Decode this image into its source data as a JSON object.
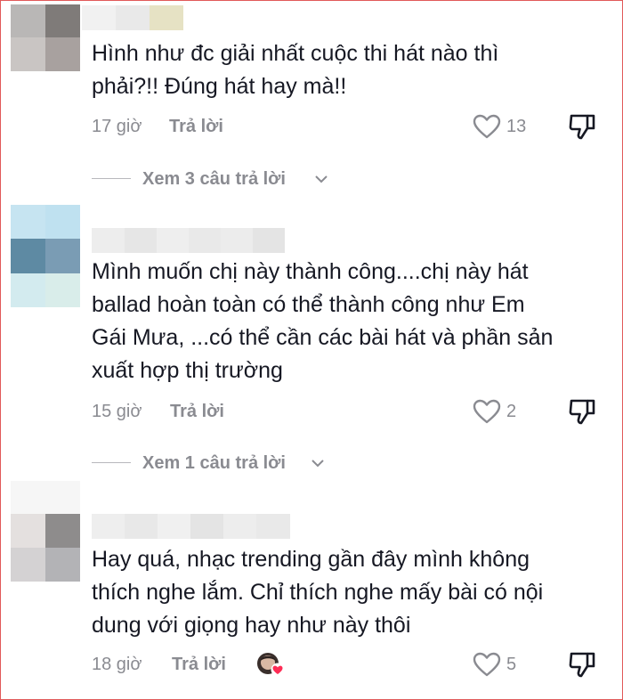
{
  "comments": [
    {
      "text_lines": [
        "Hình như đc giải nhất cuộc thi hát nào thì",
        "phải?!! Đúng hát hay mà!!"
      ],
      "time": "17 giờ",
      "reply_label": "Trả lời",
      "likes": "13",
      "view_replies": "Xem 3 câu trả lời",
      "avatar_colors": [
        "#b9b7b6",
        "#7f7b79",
        "#c9c5c3",
        "#a8a19f"
      ],
      "name_colors": [
        "#f1f1f1",
        "#e9e9e9",
        "#ecebe2",
        "#e6e2c4"
      ]
    },
    {
      "text_lines": [
        "Mình muốn chị này thành công....chị này hát",
        "ballad hoàn toàn có thể thành công như Em",
        "Gái Mưa, ...có thể cần các bài hát và phần sản",
        "xuất hợp thị trường"
      ],
      "time": "15 giờ",
      "reply_label": "Trả lời",
      "likes": "2",
      "view_replies": "Xem 1 câu trả lời",
      "avatar_colors": [
        "#c6e4f1",
        "#bfe1f0",
        "#5e8aa3",
        "#7a9cb4",
        "#d3ebef",
        "#d9edea"
      ],
      "name_colors": [
        "#ededed",
        "#e6e6e6",
        "#eeeeee",
        "#e9e9e9",
        "#ececec",
        "#e4e4e4"
      ]
    },
    {
      "text_lines": [
        "Hay quá, nhạc trending gần đây mình không",
        "thích nghe lắm. Chỉ thích nghe mấy bài có nội",
        "dung với giọng hay như này thôi"
      ],
      "time": "18 giờ",
      "reply_label": "Trả lời",
      "likes": "5",
      "avatar_colors": [
        "#e4e0df",
        "#8e8c8c",
        "#d4d2d3",
        "#b3b3b6"
      ],
      "name_colors": [
        "#eeeeee",
        "#e8e8e8",
        "#f0f0f0",
        "#e4e4e4",
        "#ededed",
        "#e9e9e9"
      ]
    }
  ],
  "icons": {
    "like": "heart-outline-icon",
    "dislike": "thumbs-down-icon",
    "expand": "chevron-down-icon",
    "creator_liked": "creator-liked-badge-icon"
  },
  "colors": {
    "text": "#161823",
    "muted": "#8a8b91",
    "heart_badge": "#fe2c55",
    "frame_border": "#e15a5a"
  }
}
